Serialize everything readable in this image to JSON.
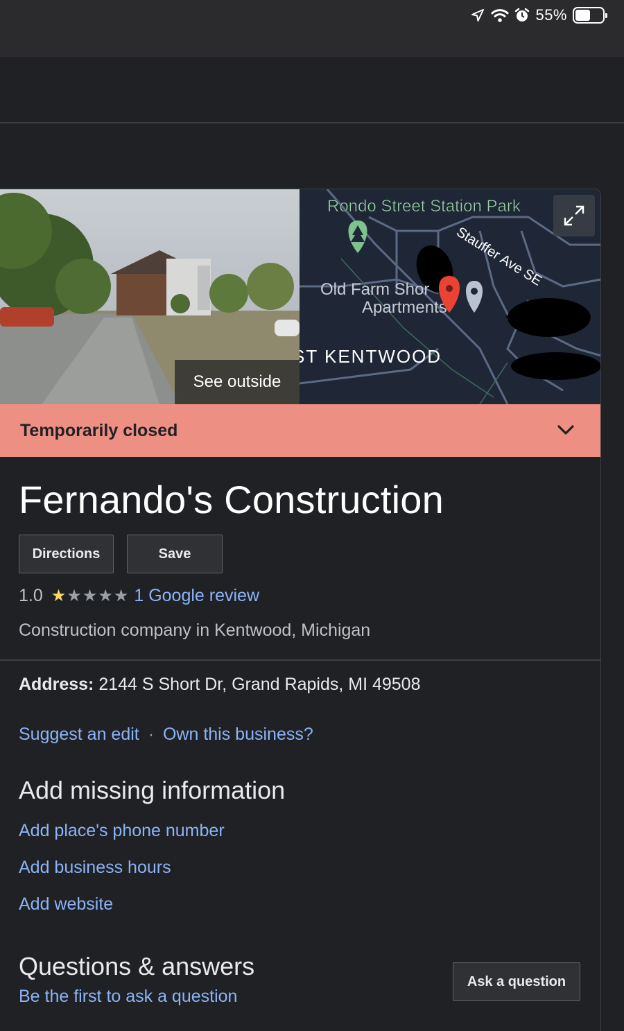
{
  "status_bar": {
    "battery_text": "55%",
    "battery_level": 0.55,
    "icons": [
      "location-arrow-icon",
      "wifi-icon",
      "alarm-icon",
      "battery-icon"
    ]
  },
  "hero": {
    "see_outside_label": "See outside",
    "map_labels": {
      "park": "Rondo Street Station Park",
      "street": "Stauffer Ave SE",
      "apartments_line1": "Old Farm Shor",
      "apartments_line2": "Apartments",
      "area": "ST KENTWOOD"
    }
  },
  "status_banner": {
    "label": "Temporarily closed",
    "color": "#ee8f83"
  },
  "business": {
    "name": "Fernando's Construction",
    "directions_label": "Directions",
    "save_label": "Save",
    "rating": "1.0",
    "rating_value": 1,
    "rating_max": 5,
    "review_link": "1 Google review",
    "category": "Construction company in Kentwood, Michigan",
    "address_label": "Address:",
    "address_value": "2144 S Short Dr, Grand Rapids, MI 49508",
    "suggest_edit": "Suggest an edit",
    "separator": "·",
    "own_business": "Own this business?"
  },
  "missing_info": {
    "heading": "Add missing information",
    "links": [
      "Add place's phone number",
      "Add business hours",
      "Add website"
    ]
  },
  "qa": {
    "heading": "Questions & answers",
    "first_question": "Be the first to ask a question",
    "ask_button": "Ask a question"
  },
  "colors": {
    "background": "#202124",
    "link": "#8ab4f8",
    "star": "#fdd663",
    "map_pin": "#ea4335"
  }
}
